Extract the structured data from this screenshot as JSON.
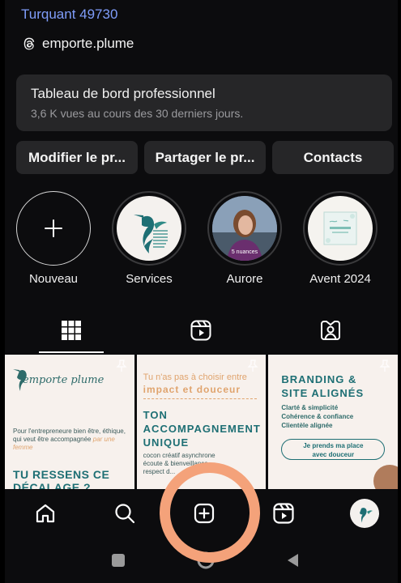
{
  "profile": {
    "location": "Turquant 49730",
    "threads_handle": "emporte.plume"
  },
  "dashboard": {
    "title": "Tableau de bord professionnel",
    "subtitle": "3,6 K vues au cours des 30 derniers jours."
  },
  "actions": {
    "edit_label": "Modifier le pr...",
    "share_label": "Partager le pr...",
    "contacts_label": "Contacts"
  },
  "highlights": [
    {
      "label": "Nouveau"
    },
    {
      "label": "Services"
    },
    {
      "label": "Aurore",
      "caption": "5 nuances"
    },
    {
      "label": "Avent 2024"
    }
  ],
  "tabs": [
    "grid-icon",
    "reels-icon",
    "tagged-icon"
  ],
  "posts": [
    {
      "logo_text": "emporte plume",
      "body": "Pour l'entrepreneure bien être, éthique, qui veut être accompagnée",
      "body_em": "par une femme",
      "headline_1": "TU RESSENS CE",
      "headline_2": "DÉCALAGE ?"
    },
    {
      "line1": "Tu n'as pas à choisir entre",
      "line2": "impact et douceur",
      "headline_1": "TON",
      "headline_2": "ACCOMPAGNEMENT",
      "headline_3": "UNIQUE",
      "small_1": "cocon créatif asynchrone",
      "small_2": "écoute & bienveillance",
      "small_3": "respect d..."
    },
    {
      "headline_1": "BRANDING &",
      "headline_2": "SITE ALIGNÉS",
      "item_1": "Clarté & simplicité",
      "item_2": "Cohérence & confiance",
      "item_3": "Clientèle alignée",
      "cta_1": "Je prends ma place",
      "cta_2": "avec douceur"
    }
  ],
  "bottom_nav": [
    "home-icon",
    "search-icon",
    "create-icon",
    "reels-icon",
    "profile-avatar"
  ],
  "colors": {
    "accent_link": "#7f9dfa",
    "teal": "#1e6f74",
    "peach": "#e0a46e",
    "annotation": "#f4a27a"
  }
}
